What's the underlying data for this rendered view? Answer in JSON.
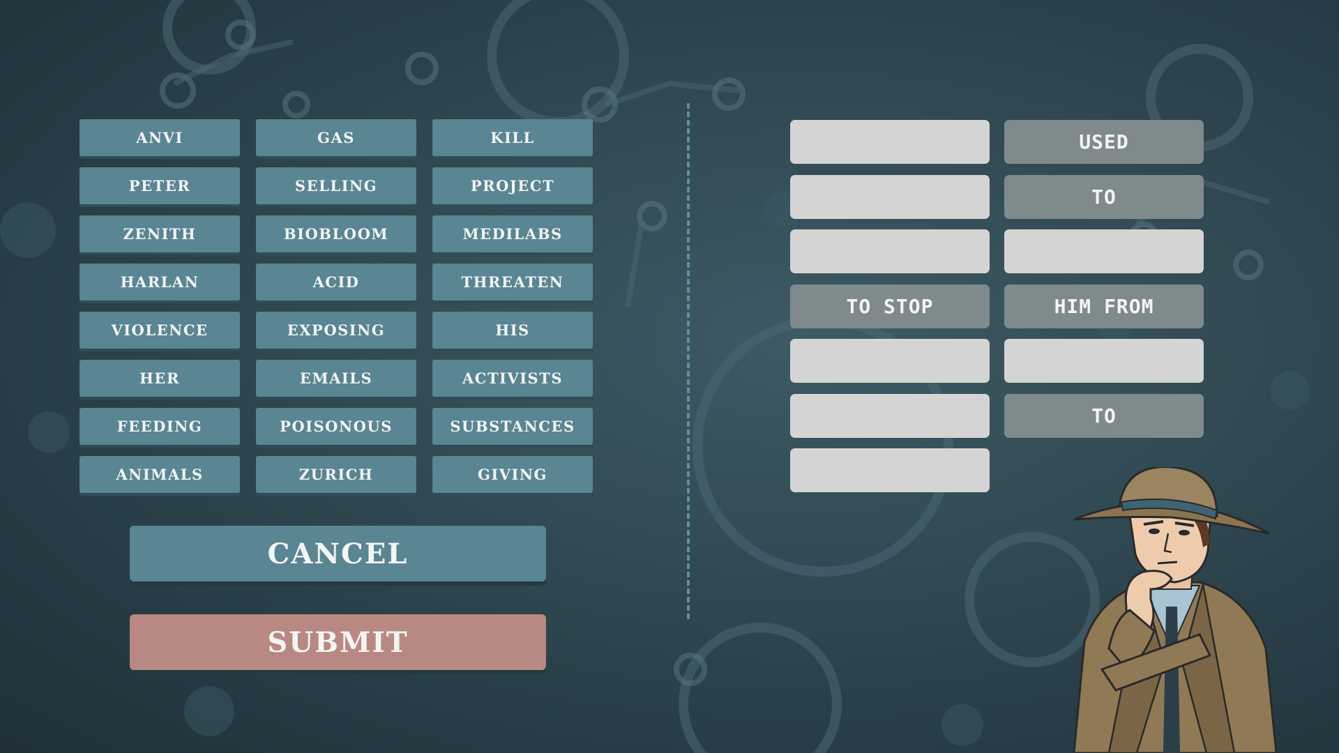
{
  "word_bank": [
    "ANVI",
    "GAS",
    "KILL",
    "PETER",
    "SELLING",
    "PROJECT",
    "ZENITH",
    "BIOBLOOM",
    "MEDILABS",
    "HARLAN",
    "ACID",
    "THREATEN",
    "VIOLENCE",
    "EXPOSING",
    "HIS",
    "HER",
    "EMAILS",
    "ACTIVISTS",
    "FEEDING",
    "POISONOUS",
    "SUBSTANCES",
    "ANIMALS",
    "ZURICH",
    "GIVING"
  ],
  "buttons": {
    "cancel": "CANCEL",
    "submit": "SUBMIT"
  },
  "sentence_slots": [
    {
      "col": 0,
      "row": 0,
      "text": ""
    },
    {
      "col": 1,
      "row": 0,
      "text": "USED"
    },
    {
      "col": 0,
      "row": 1,
      "text": ""
    },
    {
      "col": 1,
      "row": 1,
      "text": "TO"
    },
    {
      "col": 0,
      "row": 2,
      "text": ""
    },
    {
      "col": 1,
      "row": 2,
      "text": ""
    },
    {
      "col": 0,
      "row": 3,
      "text": "TO STOP"
    },
    {
      "col": 1,
      "row": 3,
      "text": "HIM FROM"
    },
    {
      "col": 0,
      "row": 4,
      "text": ""
    },
    {
      "col": 1,
      "row": 4,
      "text": ""
    },
    {
      "col": 0,
      "row": 5,
      "text": ""
    },
    {
      "col": 1,
      "row": 5,
      "text": "TO"
    },
    {
      "col": 0,
      "row": 6,
      "text": ""
    }
  ],
  "colors": {
    "tile": "#5a8592",
    "submit": "#b88883",
    "slot_empty": "#d4d4d4",
    "slot_filled": "#7f8a8d"
  },
  "character": "detective-thinking-icon"
}
